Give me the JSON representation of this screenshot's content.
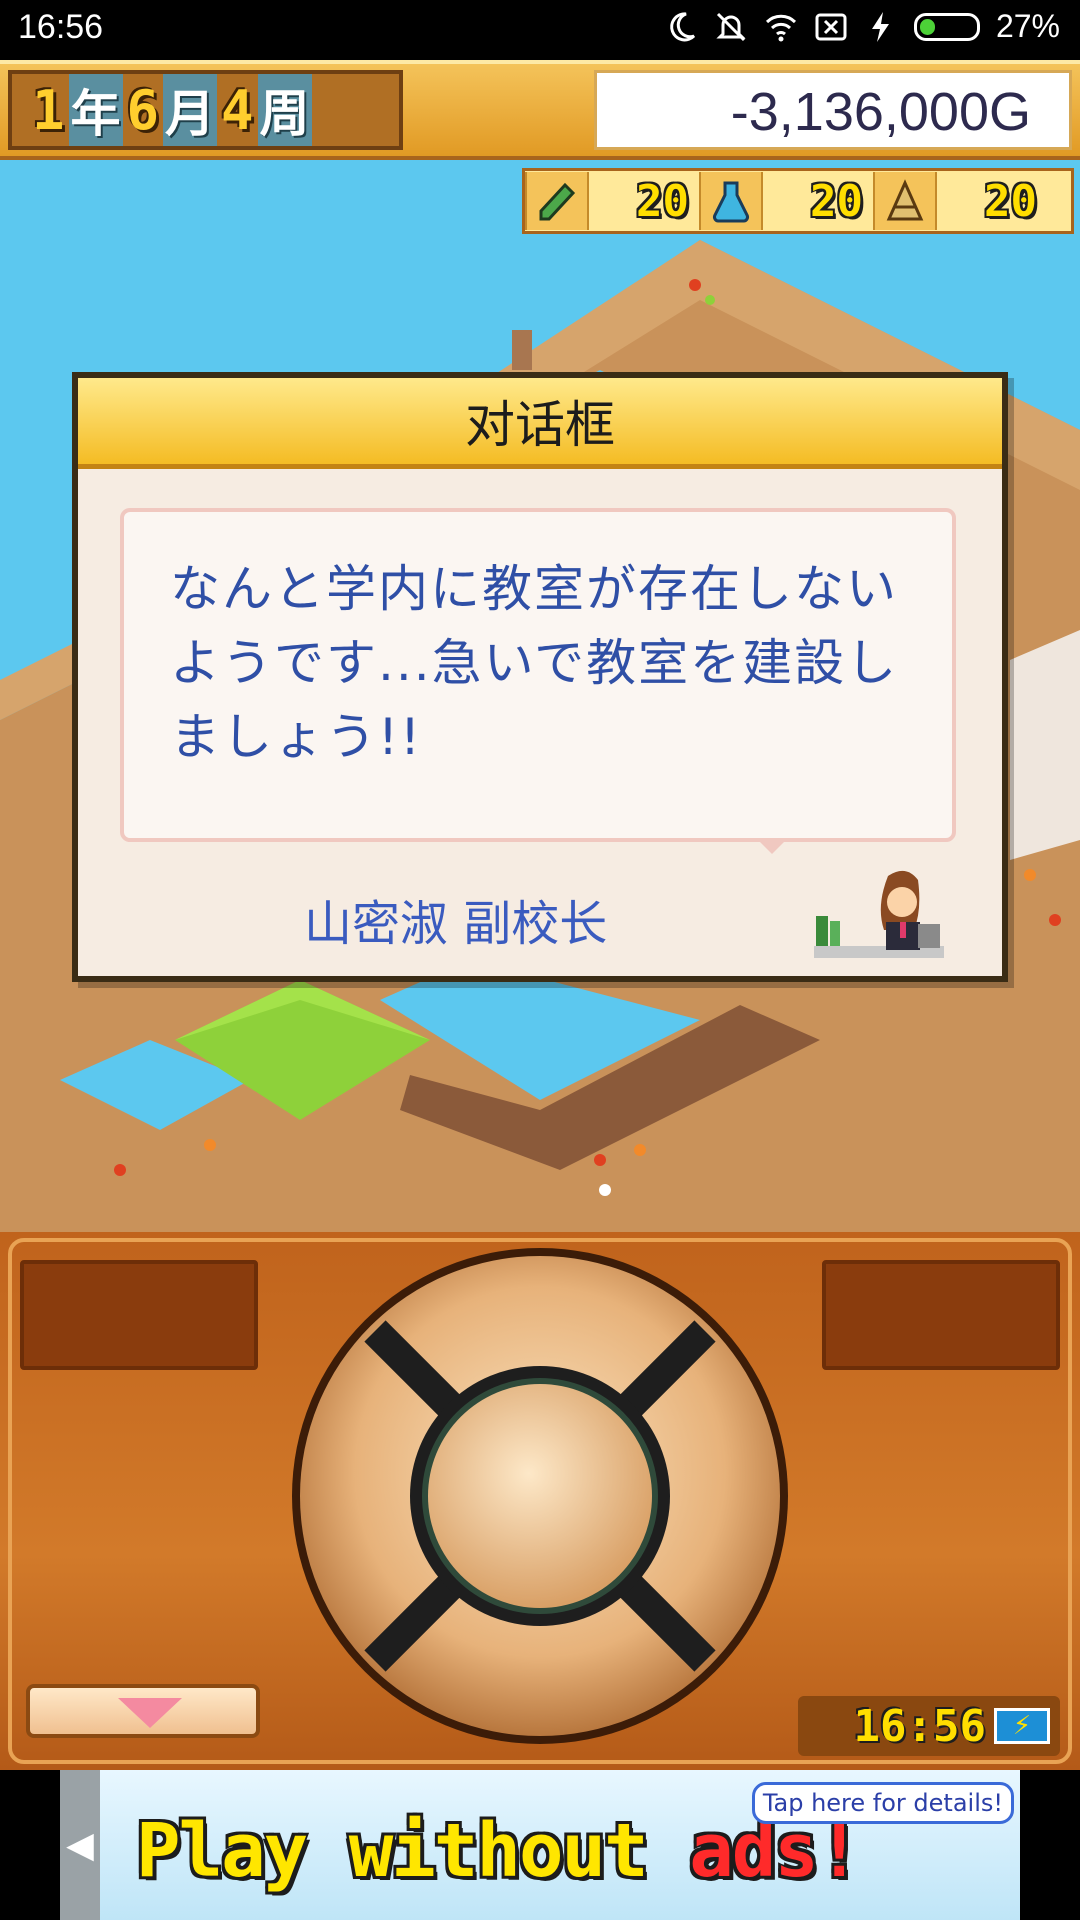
{
  "status_bar": {
    "time": "16:56",
    "battery_text": "27%",
    "battery_level": 0.27,
    "icons": [
      "moon-icon",
      "bell-off-icon",
      "wifi-icon",
      "sim-off-icon",
      "charging-bolt-icon",
      "battery-icon"
    ]
  },
  "header": {
    "year_num": "1",
    "year_label": "年",
    "month_num": "6",
    "month_label": "月",
    "week_num": "4",
    "week_label": "周",
    "money": "-3,136,000G"
  },
  "stats": [
    {
      "icon": "pencil-icon",
      "value": "20"
    },
    {
      "icon": "flask-icon",
      "value": "20"
    },
    {
      "icon": "pyramid-icon",
      "value": "20"
    }
  ],
  "dialog": {
    "title": "对话框",
    "lines": [
      "なんと学内に教室が存在しない",
      "ようです...急いで教室を建設し",
      "ましょう!!"
    ],
    "speaker": "山密淑 副校长"
  },
  "controller": {
    "clock": "16:56"
  },
  "ad": {
    "headline_part1": "Play without ",
    "headline_part2": "ads!",
    "cta": "Tap here for details!"
  },
  "colors": {
    "header_gold": "#f4c35a",
    "dialog_text": "#2f4fa6",
    "controller_orange": "#c0631c",
    "water": "#5cc8ef",
    "dirt": "#c9925a"
  }
}
